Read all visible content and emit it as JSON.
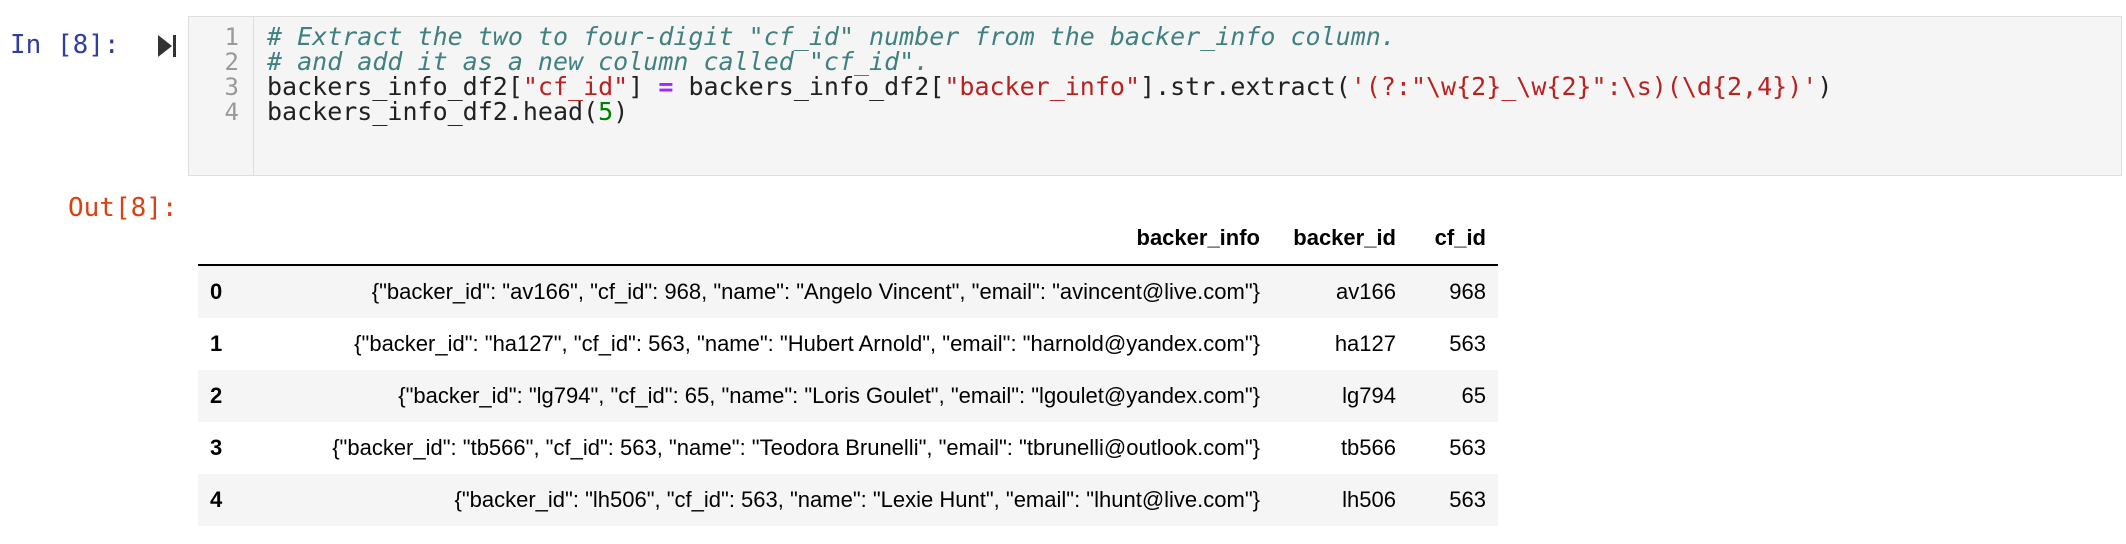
{
  "input_cell": {
    "prompt": "In [8]:",
    "line_numbers": [
      "1",
      "2",
      "3",
      "4"
    ],
    "comment_1": "# Extract the two to four-digit \"cf_id\" number from the backer_info column.",
    "comment_2": "# and add it as a new column called \"cf_id\".",
    "line3": {
      "var1": "backers_info_df2[",
      "str1": "\"cf_id\"",
      "close1": "] ",
      "op": "=",
      "var2": " backers_info_df2[",
      "str2": "\"backer_info\"",
      "call": "].str.extract(",
      "regex": "'(?:\"\\w{2}_\\w{2}\":\\s)(\\d{2,4})'",
      "close2": ")"
    },
    "line4": {
      "call": "backers_info_df2.head(",
      "num": "5",
      "close": ")"
    }
  },
  "output_cell": {
    "prompt": "Out[8]:",
    "table": {
      "columns": [
        "",
        "backer_info",
        "backer_id",
        "cf_id"
      ],
      "rows": [
        {
          "index": "0",
          "backer_info": "{\"backer_id\": \"av166\", \"cf_id\": 968, \"name\": \"Angelo Vincent\", \"email\": \"avincent@live.com\"}",
          "backer_id": "av166",
          "cf_id": "968"
        },
        {
          "index": "1",
          "backer_info": "{\"backer_id\": \"ha127\", \"cf_id\": 563, \"name\": \"Hubert Arnold\", \"email\": \"harnold@yandex.com\"}",
          "backer_id": "ha127",
          "cf_id": "563"
        },
        {
          "index": "2",
          "backer_info": "{\"backer_id\": \"lg794\", \"cf_id\": 65, \"name\": \"Loris Goulet\", \"email\": \"lgoulet@yandex.com\"}",
          "backer_id": "lg794",
          "cf_id": "65"
        },
        {
          "index": "3",
          "backer_info": "{\"backer_id\": \"tb566\", \"cf_id\": 563, \"name\": \"Teodora Brunelli\", \"email\": \"tbrunelli@outlook.com\"}",
          "backer_id": "tb566",
          "cf_id": "563"
        },
        {
          "index": "4",
          "backer_info": "{\"backer_id\": \"lh506\", \"cf_id\": 563, \"name\": \"Lexie Hunt\", \"email\": \"lhunt@live.com\"}",
          "backer_id": "lh506",
          "cf_id": "563"
        }
      ]
    }
  },
  "colors": {
    "in_prompt": "#303f9f",
    "out_prompt": "#d84315",
    "comment": "#408080",
    "string": "#ba2121",
    "operator": "#aa22ff",
    "number": "#008000"
  },
  "icons": {
    "run": "run-cell-icon"
  }
}
